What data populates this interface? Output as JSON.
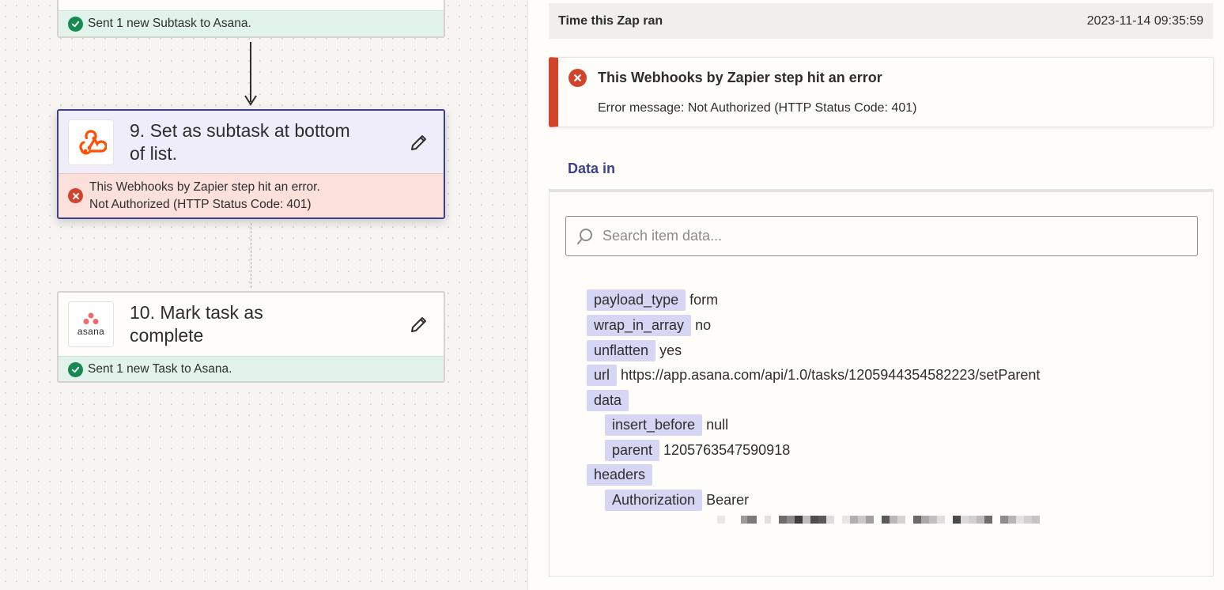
{
  "canvas": {
    "prev_step": {
      "status_text": "Sent 1 new Subtask to Asana."
    },
    "step9": {
      "title": "9. Set as subtask at bottom of list.",
      "error_line1": "This Webhooks by Zapier step hit an error.",
      "error_line2": "Not Authorized (HTTP Status Code: 401)",
      "app_icon": "webhook-icon"
    },
    "step10": {
      "title": "10. Mark task as complete",
      "status_text": "Sent 1 new Task to Asana.",
      "app_icon": "asana-logo",
      "logo_text": "asana"
    }
  },
  "panel": {
    "ran_label": "Time this Zap ran",
    "ran_value": "2023-11-14 09:35:59",
    "error": {
      "title": "This Webhooks by Zapier step hit an error",
      "message": "Error message: Not Authorized (HTTP Status Code: 401)"
    },
    "tab_label": "Data in",
    "search_placeholder": "Search item data...",
    "data": [
      {
        "key": "payload_type",
        "value": "form"
      },
      {
        "key": "wrap_in_array",
        "value": "no"
      },
      {
        "key": "unflatten",
        "value": "yes"
      },
      {
        "key": "url",
        "value": "https://app.asana.com/api/1.0/tasks/1205944354582223/setParent"
      },
      {
        "key": "data",
        "value": ""
      },
      {
        "key": "insert_before",
        "value": "null"
      },
      {
        "key": "parent",
        "value": "1205763547590918"
      },
      {
        "key": "headers",
        "value": ""
      },
      {
        "key": "Authorization",
        "value": "Bearer"
      }
    ]
  },
  "colors": {
    "accent": "#3d3f8f",
    "error": "#d2432b",
    "success": "#178a52",
    "key_bg": "#d6d6f4"
  }
}
